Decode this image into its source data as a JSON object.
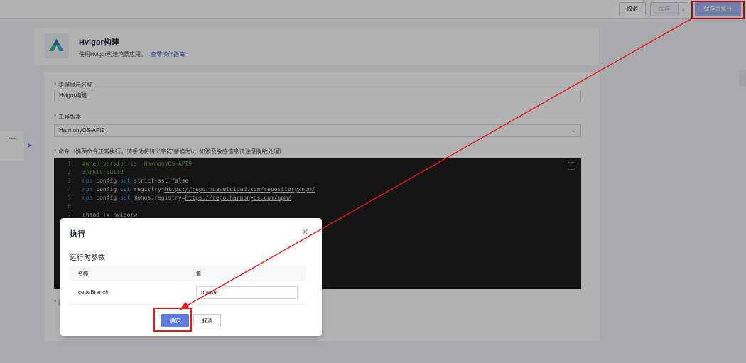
{
  "toolbar": {
    "cancel_label": "取消",
    "save_label": "保存",
    "save_run_label": "保存并执行"
  },
  "header": {
    "title": "Hvigor构建",
    "description": "使用Hvigor构建鸿蒙应用。",
    "guide_link": "查看操作指南"
  },
  "form": {
    "step_name_label": "步骤显示名称",
    "step_name_value": "Hvigor构建",
    "tool_version_label": "工具版本",
    "tool_version_value": "HarmonyOS-API9",
    "command_label": "命令（确保命令正常执行，请手动将转义字符\\替换为\\\\；如涉及敏感信息请注意脱敏处理）",
    "partial_label": "失"
  },
  "editor": {
    "lines": [
      {
        "num": "1",
        "text": "#when version is  HarmonyOS-API9"
      },
      {
        "num": "2",
        "text": "#ArkTS Build"
      },
      {
        "num": "3",
        "text": "npm config set strict-ssl false"
      },
      {
        "num": "4",
        "text": "npm config set registry=https://repo.huaweicloud.com/repository/npm/"
      },
      {
        "num": "5",
        "text": "npm config set @ohos:registry=https://repo.harmonyos.com/npm/"
      },
      {
        "num": "6",
        "text": ""
      },
      {
        "num": "7",
        "text": "chmod +x hvigorw"
      }
    ]
  },
  "sidebar": {
    "more_label": "···"
  },
  "modal": {
    "title": "执行",
    "section_title": "运行时参数",
    "col_name": "名称",
    "col_value": "值",
    "param_name": "codeBranch",
    "param_value": "master",
    "ok_label": "确定",
    "cancel_label": "取消"
  },
  "colors": {
    "accent": "#5e7ce0",
    "highlight": "#e8161b"
  }
}
